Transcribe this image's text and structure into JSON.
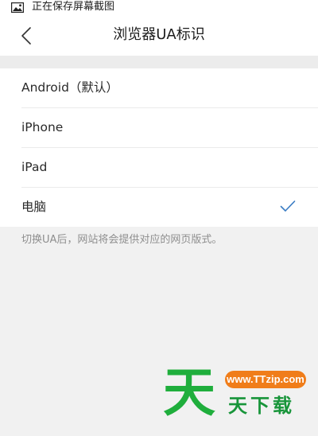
{
  "status_bar": {
    "icon": "image-icon",
    "text": "正在保存屏幕截图"
  },
  "nav": {
    "back_icon": "chevron-left-icon",
    "title": "浏览器UA标识"
  },
  "options": [
    {
      "label": "Android（默认）",
      "selected": false
    },
    {
      "label": "iPhone",
      "selected": false
    },
    {
      "label": "iPad",
      "selected": false
    },
    {
      "label": "电脑",
      "selected": true
    }
  ],
  "selected_icon": "checkmark-icon",
  "footer_note": "切换UA后，网站将会提供对应的网页版式。",
  "watermark": {
    "big_char": "天",
    "url": "www.TTzip.com",
    "text": "天下载"
  },
  "colors": {
    "accent": "#3b7dc4",
    "watermark_green": "#1fae3c",
    "watermark_orange": "#f07d1a"
  }
}
